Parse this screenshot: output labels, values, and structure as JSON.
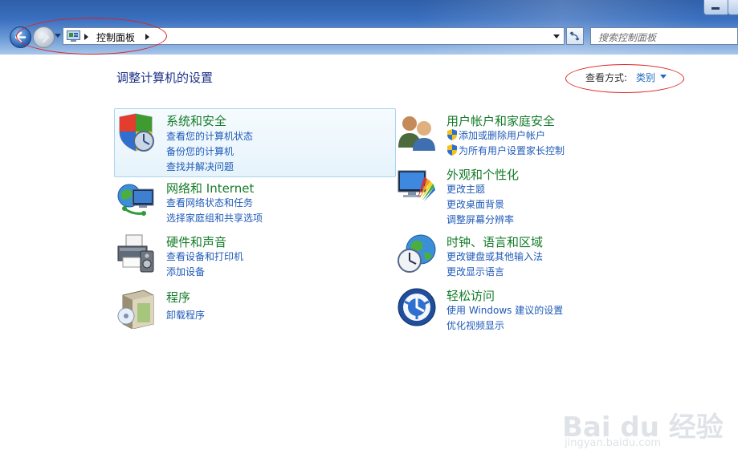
{
  "window": {
    "address_path": [
      "控制面板"
    ],
    "search_placeholder": "搜索控制面板"
  },
  "page": {
    "title": "调整计算机的设置",
    "view_by_label": "查看方式:",
    "view_by_value": "类别"
  },
  "categories": [
    {
      "icon": "shield-security-icon",
      "heading": "系统和安全",
      "links": [
        "查看您的计算机状态",
        "备份您的计算机",
        "查找并解决问题"
      ]
    },
    {
      "icon": "network-globe-icon",
      "heading": "网络和 Internet",
      "links": [
        "查看网络状态和任务",
        "选择家庭组和共享选项"
      ]
    },
    {
      "icon": "printer-icon",
      "heading": "硬件和声音",
      "links": [
        "查看设备和打印机",
        "添加设备"
      ]
    },
    {
      "icon": "programs-box-icon",
      "heading": "程序",
      "links": [
        "卸载程序"
      ]
    },
    {
      "icon": "users-icon",
      "heading": "用户帐户和家庭安全",
      "links": [
        "添加或删除用户帐户",
        "为所有用户设置家长控制"
      ]
    },
    {
      "icon": "monitor-palette-icon",
      "heading": "外观和个性化",
      "links": [
        "更改主题",
        "更改桌面背景",
        "调整屏幕分辨率"
      ]
    },
    {
      "icon": "clock-globe-icon",
      "heading": "时钟、语言和区域",
      "links": [
        "更改键盘或其他输入法",
        "更改显示语言"
      ]
    },
    {
      "icon": "ease-of-access-icon",
      "heading": "轻松访问",
      "links": [
        "使用 Windows 建议的设置",
        "优化视频显示"
      ]
    }
  ],
  "watermark": {
    "brand": "Bai du 经验",
    "url": "jingyan.baidu.com"
  }
}
